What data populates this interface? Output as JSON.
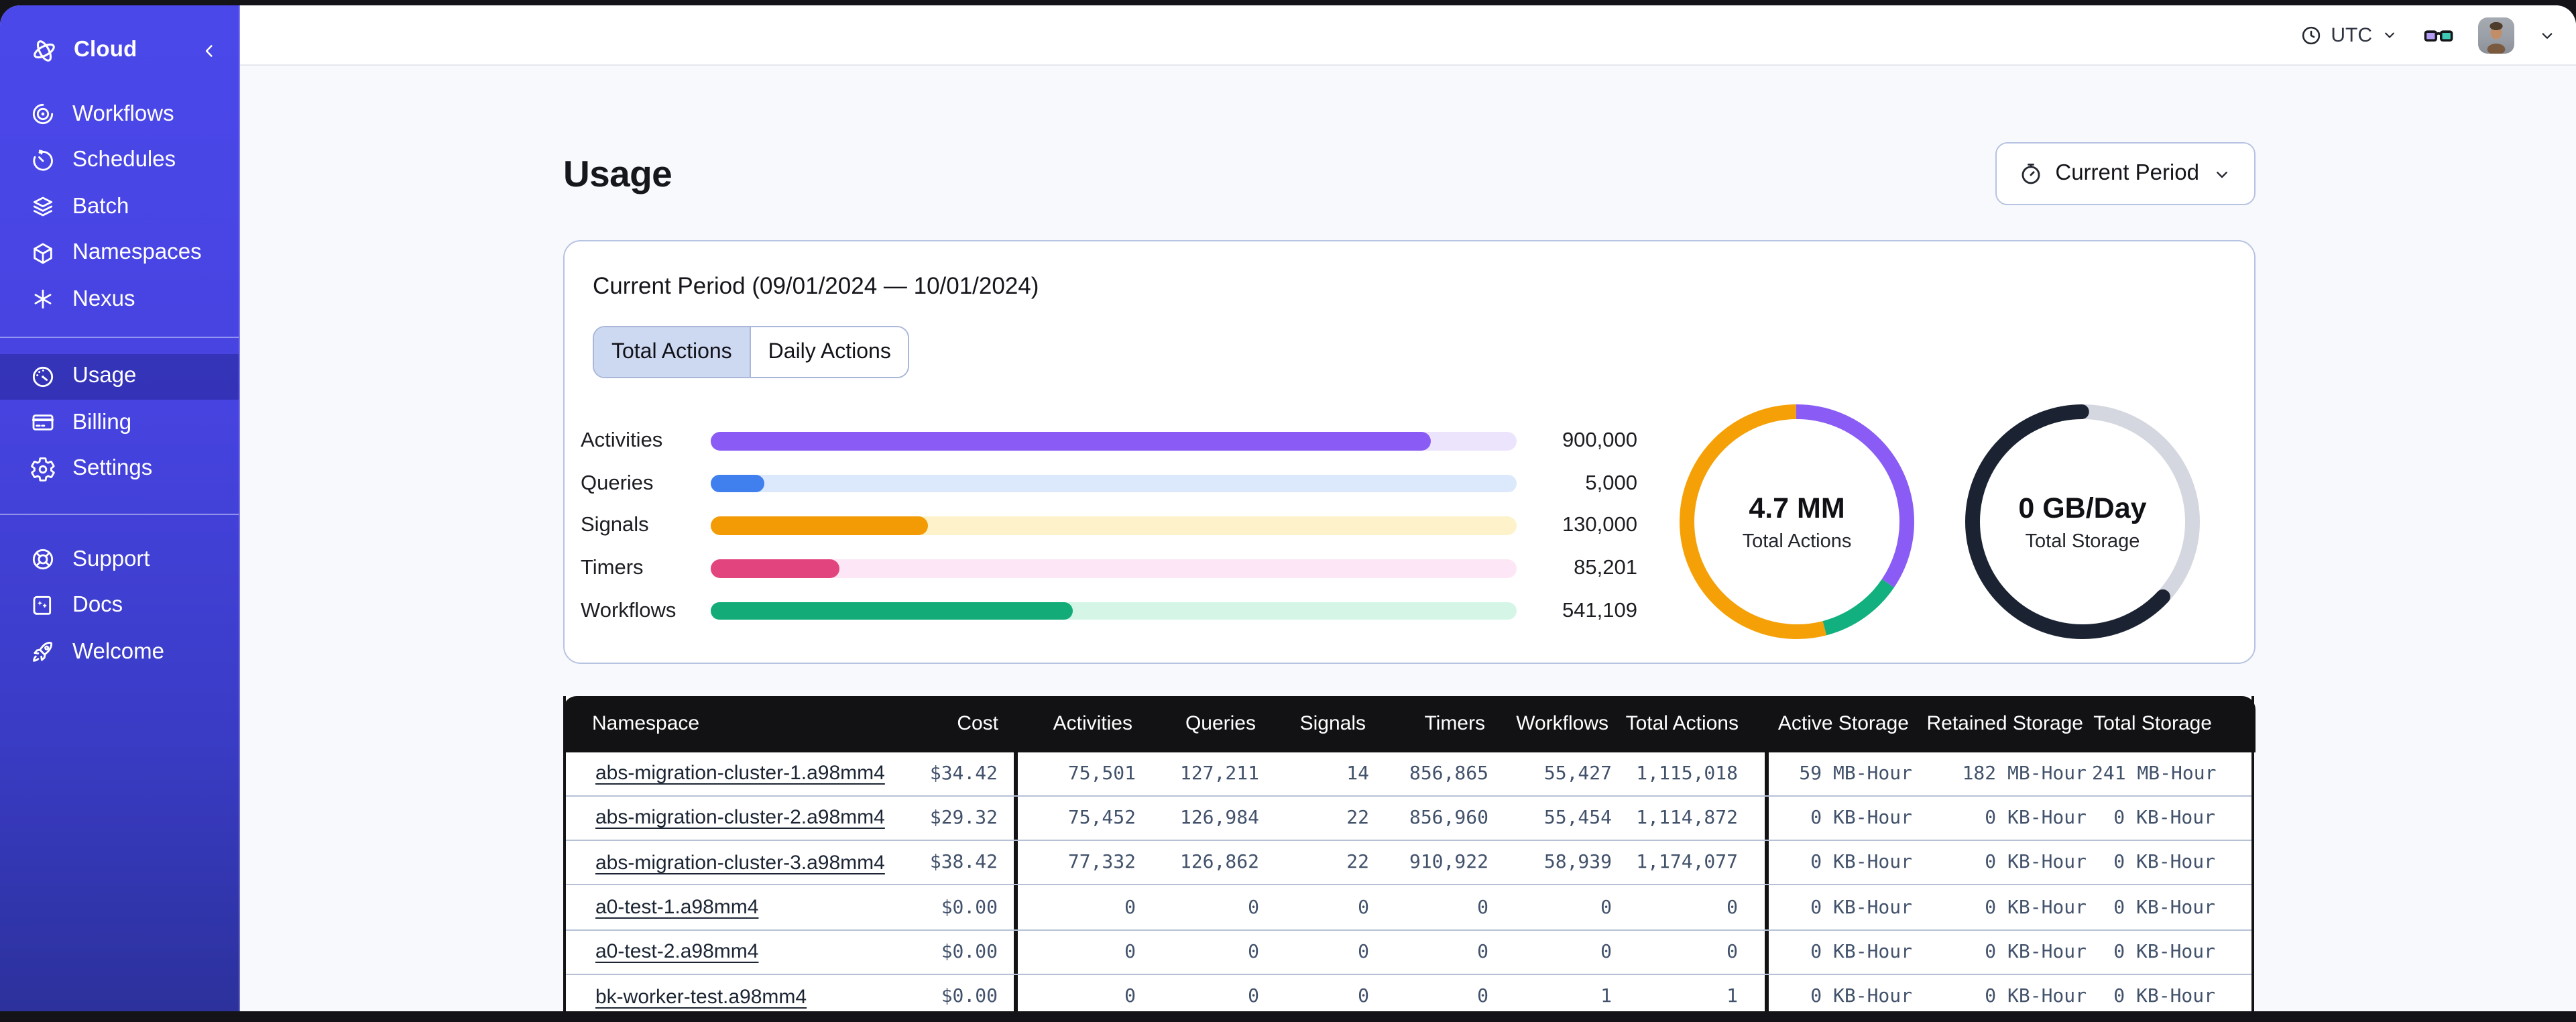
{
  "sidebar": {
    "header": {
      "label": "Cloud"
    },
    "nav_items": [
      {
        "label": "Workflows"
      },
      {
        "label": "Schedules"
      },
      {
        "label": "Batch"
      },
      {
        "label": "Namespaces"
      },
      {
        "label": "Nexus"
      }
    ],
    "account_items": [
      {
        "label": "Usage",
        "selected": true
      },
      {
        "label": "Billing",
        "selected": false
      },
      {
        "label": "Settings",
        "selected": false
      }
    ],
    "footer_items": [
      {
        "label": "Support"
      },
      {
        "label": "Docs"
      },
      {
        "label": "Welcome"
      }
    ]
  },
  "topbar": {
    "timezone": "UTC"
  },
  "page": {
    "title": "Usage",
    "period_selector_label": "Current Period"
  },
  "usage_card": {
    "title": "Current Period (09/01/2024 — 10/01/2024)",
    "tabs": [
      {
        "label": "Total Actions",
        "selected": true
      },
      {
        "label": "Daily Actions",
        "selected": false
      }
    ]
  },
  "chart_data": [
    {
      "type": "bar",
      "orientation": "horizontal",
      "categories": [
        "Activities",
        "Queries",
        "Signals",
        "Timers",
        "Workflows"
      ],
      "values": [
        900000,
        5000,
        130000,
        85201,
        541109
      ],
      "value_labels": [
        "900,000",
        "5,000",
        "130,000",
        "85,201",
        "541,109"
      ],
      "bar_fractions": [
        0.893,
        0.067,
        0.269,
        0.159,
        0.449
      ],
      "bar_colors": [
        "#8a5cf5",
        "#4080ee",
        "#f29b05",
        "#e2447e",
        "#13ac79"
      ],
      "track_colors": [
        "#ece4fc",
        "#dce8fb",
        "#fdf2ca",
        "#fde6f5",
        "#d5f6e7"
      ]
    },
    {
      "type": "pie",
      "center": {
        "value": "4.7 MM",
        "label": "Total Actions"
      },
      "slices": [
        {
          "name": "activities",
          "pct": 34.5,
          "color": "#8a5cf5"
        },
        {
          "name": "workflows",
          "pct": 11.5,
          "color": "#12b07e"
        },
        {
          "name": "signals",
          "pct": 54,
          "color": "#f5a006"
        }
      ]
    },
    {
      "type": "pie",
      "center": {
        "value": "0 GB/Day",
        "label": "Total Storage"
      },
      "slices": [
        {
          "name": "empty",
          "pct": 37,
          "color": "#d4d7df"
        },
        {
          "name": "storage",
          "pct": 63,
          "color": "#1b2333",
          "cap": "round",
          "offset": 37
        }
      ]
    }
  ],
  "table": {
    "columns": [
      {
        "key": "namespace",
        "label": "Namespace"
      },
      {
        "key": "cost",
        "label": "Cost"
      },
      {
        "key": "activities",
        "label": "Activities"
      },
      {
        "key": "queries",
        "label": "Queries"
      },
      {
        "key": "signals",
        "label": "Signals"
      },
      {
        "key": "timers",
        "label": "Timers"
      },
      {
        "key": "workflows",
        "label": "Workflows"
      },
      {
        "key": "total_actions",
        "label": "Total Actions"
      },
      {
        "key": "active_storage",
        "label": "Active Storage"
      },
      {
        "key": "retained_storage",
        "label": "Retained Storage"
      },
      {
        "key": "total_storage",
        "label": "Total Storage"
      }
    ],
    "rows": [
      {
        "namespace": "abs-migration-cluster-1.a98mm4",
        "cost": "$34.42",
        "activities": "75,501",
        "queries": "127,211",
        "signals": "14",
        "timers": "856,865",
        "workflows": "55,427",
        "total_actions": "1,115,018",
        "active_storage": "59 MB-Hour",
        "retained_storage": "182 MB-Hour",
        "total_storage": "241 MB-Hour"
      },
      {
        "namespace": "abs-migration-cluster-2.a98mm4",
        "cost": "$29.32",
        "activities": "75,452",
        "queries": "126,984",
        "signals": "22",
        "timers": "856,960",
        "workflows": "55,454",
        "total_actions": "1,114,872",
        "active_storage": "0 KB-Hour",
        "retained_storage": "0 KB-Hour",
        "total_storage": "0 KB-Hour"
      },
      {
        "namespace": "abs-migration-cluster-3.a98mm4",
        "cost": "$38.42",
        "activities": "77,332",
        "queries": "126,862",
        "signals": "22",
        "timers": "910,922",
        "workflows": "58,939",
        "total_actions": "1,174,077",
        "active_storage": "0 KB-Hour",
        "retained_storage": "0 KB-Hour",
        "total_storage": "0 KB-Hour"
      },
      {
        "namespace": "a0-test-1.a98mm4",
        "cost": "$0.00",
        "activities": "0",
        "queries": "0",
        "signals": "0",
        "timers": "0",
        "workflows": "0",
        "total_actions": "0",
        "active_storage": "0 KB-Hour",
        "retained_storage": "0 KB-Hour",
        "total_storage": "0 KB-Hour"
      },
      {
        "namespace": "a0-test-2.a98mm4",
        "cost": "$0.00",
        "activities": "0",
        "queries": "0",
        "signals": "0",
        "timers": "0",
        "workflows": "0",
        "total_actions": "0",
        "active_storage": "0 KB-Hour",
        "retained_storage": "0 KB-Hour",
        "total_storage": "0 KB-Hour"
      },
      {
        "namespace": "bk-worker-test.a98mm4",
        "cost": "$0.00",
        "activities": "0",
        "queries": "0",
        "signals": "0",
        "timers": "0",
        "workflows": "1",
        "total_actions": "1",
        "active_storage": "0 KB-Hour",
        "retained_storage": "0 KB-Hour",
        "total_storage": "0 KB-Hour"
      }
    ]
  }
}
